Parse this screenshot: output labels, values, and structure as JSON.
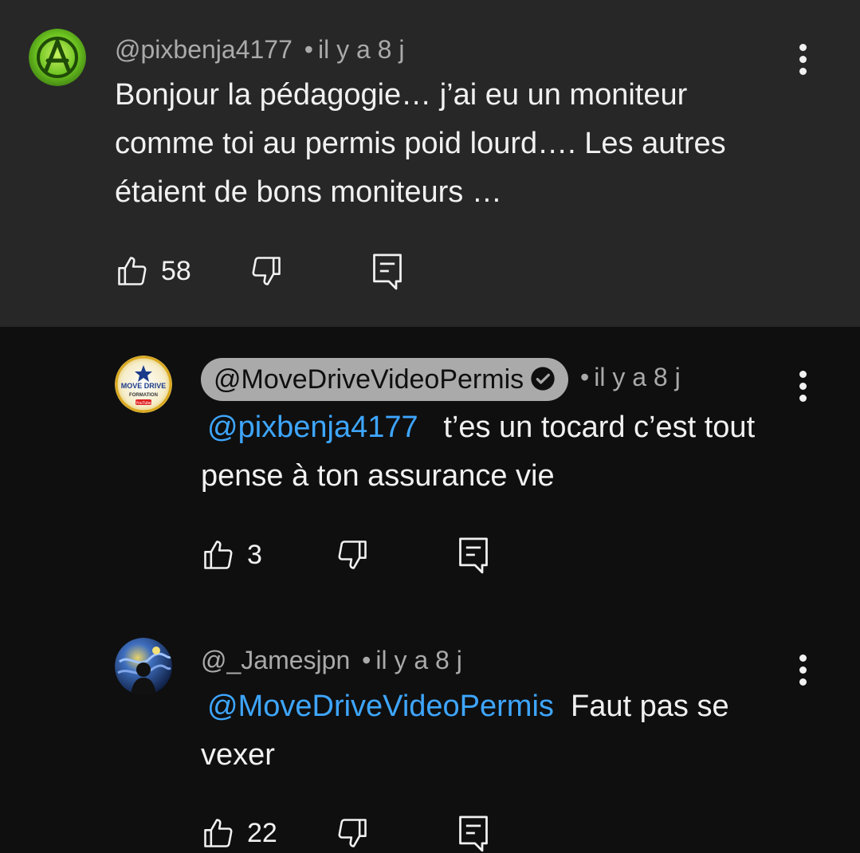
{
  "comments": [
    {
      "author": "@pixbenja4177",
      "separator": "•",
      "time": "il y a 8 j",
      "text": "Bonjour la pédagogie… j’ai eu un moniteur comme toi au permis poid lourd…. Les autres étaient de bons moniteurs …",
      "likes": "58",
      "avatar": "green-anarchy-avatar"
    },
    {
      "author": "@MoveDriveVideoPermis",
      "verified": true,
      "separator": "•",
      "time": "il y a 8 j",
      "mention": "@pixbenja4177",
      "text": "t’es un tocard c’est tout pense à ton assurance vie",
      "likes": "3",
      "avatar_text": {
        "line1": "MOVE DRIVE",
        "line2": "FORMATION",
        "line3": "YouTube"
      }
    },
    {
      "author": "@_Jamesjpn",
      "separator": "•",
      "time": "il y a 8 j",
      "mention": "@MoveDriveVideoPermis",
      "text": "Faut pas se vexer",
      "likes": "22",
      "avatar": "starry-night-avatar"
    }
  ],
  "icons": {
    "like": "thumbs-up-icon",
    "dislike": "thumbs-down-icon",
    "reply": "reply-icon",
    "menu": "more-vert-icon",
    "verified": "check-circle-icon"
  },
  "colors": {
    "top_bg": "#272727",
    "reply_bg": "#0f0f0f",
    "mention": "#3ea6ff",
    "secondary_text": "#aaaaaa"
  }
}
